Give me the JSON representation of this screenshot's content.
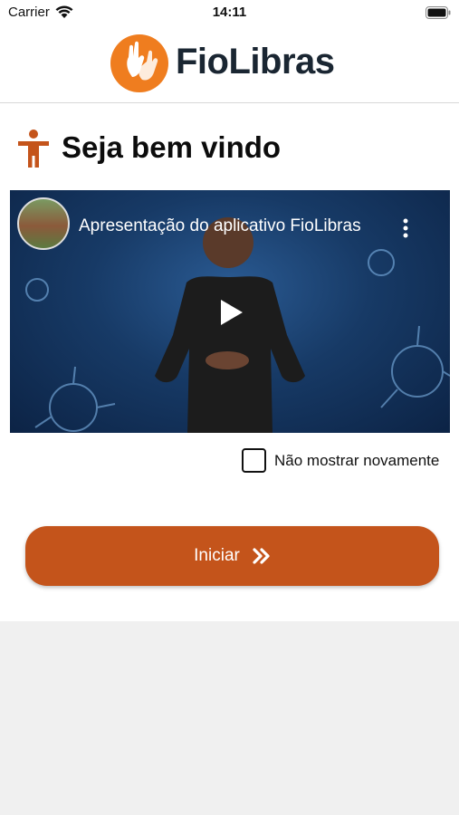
{
  "status_bar": {
    "carrier": "Carrier",
    "time": "14:11"
  },
  "header": {
    "app_name": "FioLibras",
    "brand_color": "#ef7d1f"
  },
  "welcome": {
    "title": "Seja bem vindo",
    "icon": "accessibility-person-icon"
  },
  "video": {
    "title": "Apresentação do aplicativo FioLibras",
    "icons": [
      "channel-avatar",
      "more-vertical-icon",
      "play-icon"
    ]
  },
  "options": {
    "dont_show_again_label": "Não mostrar novamente",
    "dont_show_again_checked": false
  },
  "actions": {
    "start_label": "Iniciar",
    "start_icon": "double-chevron-right-icon",
    "accent_color": "#c4541b"
  }
}
